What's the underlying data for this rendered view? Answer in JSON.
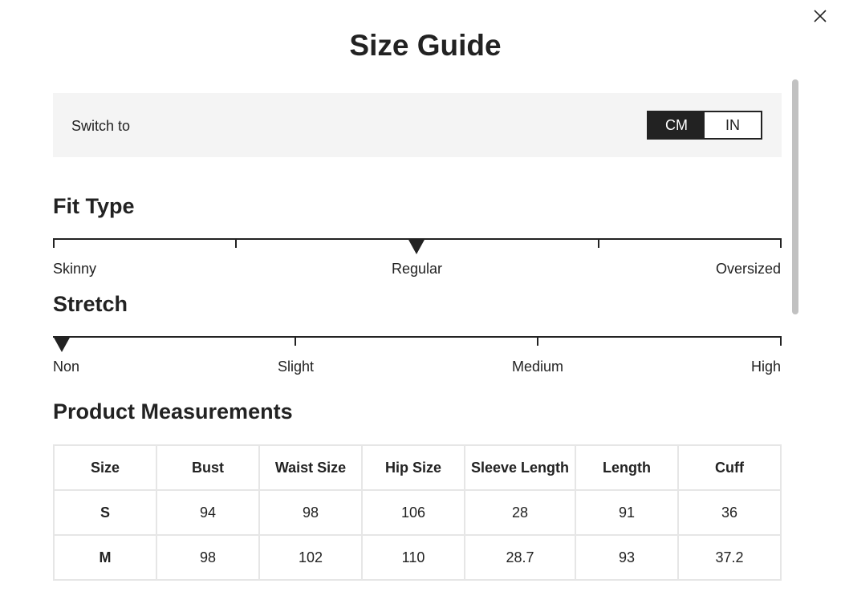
{
  "modal": {
    "title": "Size Guide",
    "close_icon": "close-icon"
  },
  "units": {
    "label": "Switch to",
    "options": [
      "CM",
      "IN"
    ],
    "selected": "CM"
  },
  "fit_type": {
    "title": "Fit Type",
    "labels": [
      "Skinny",
      "Regular",
      "Oversized"
    ],
    "selected": "Regular"
  },
  "stretch": {
    "title": "Stretch",
    "labels": [
      "Non",
      "Slight",
      "Medium",
      "High"
    ],
    "selected": "Non"
  },
  "measurements": {
    "title": "Product Measurements",
    "headers": [
      "Size",
      "Bust",
      "Waist Size",
      "Hip Size",
      "Sleeve Length",
      "Length",
      "Cuff"
    ],
    "rows": [
      [
        "S",
        "94",
        "98",
        "106",
        "28",
        "91",
        "36"
      ],
      [
        "M",
        "98",
        "102",
        "110",
        "28.7",
        "93",
        "37.2"
      ]
    ]
  },
  "colors": {
    "text": "#222222",
    "panel": "#f4f4f4",
    "border": "#e6e6e6",
    "scrollbar": "#c1c1c1"
  }
}
